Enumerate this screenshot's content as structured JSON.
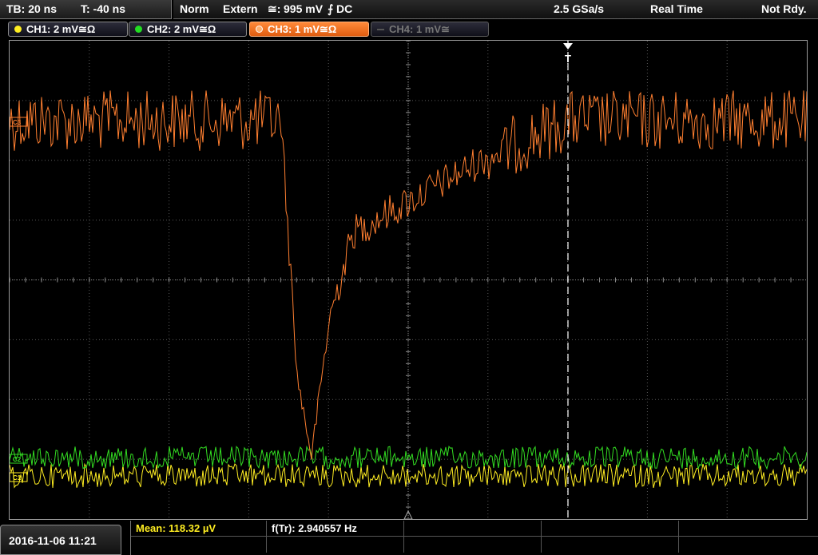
{
  "timebase": {
    "tb_label": "TB: 20 ns",
    "t_label": "T: -40 ns"
  },
  "status": {
    "mode": "Norm",
    "trigger_source": "Extern",
    "trigger_coupling_symbol": "≅:",
    "trigger_level": "995 mV",
    "trigger_slope_symbol": "⨍",
    "trigger_coupling": "DC",
    "sample_rate": "2.5 GSa/s",
    "acquisition": "Real Time",
    "state": "Not Rdy."
  },
  "channels": [
    {
      "label": "CH1: 2 mV≅Ω",
      "color": "#ffee22",
      "state": "on"
    },
    {
      "label": "CH2: 2 mV≅Ω",
      "color": "#22dd22",
      "state": "on"
    },
    {
      "label": "CH3: 1 mV≅Ω",
      "color": "#ff8030",
      "state": "active"
    },
    {
      "label": "CH4: 1 mV≅",
      "color": "#777777",
      "state": "off"
    }
  ],
  "markers": {
    "trigger_marker": "T",
    "ch3_ref": "C3",
    "ch2_ref": "C2",
    "ch1_ref": "C1"
  },
  "measurements": {
    "mean_label": "Mean: 118.32 µV",
    "freq_label": "f(Tr): 2.940557 Hz"
  },
  "datetime": "2016-11-06 11:21",
  "colors": {
    "ch1": "#ffee22",
    "ch2": "#33dd22",
    "ch3": "#ff7f30",
    "grid": "#5a5a5a",
    "grid_axis": "#8a8a8a"
  }
}
